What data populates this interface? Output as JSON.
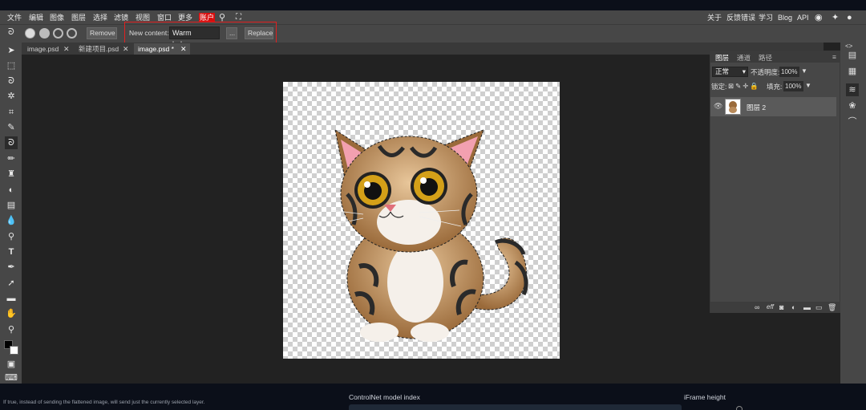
{
  "menu": {
    "items": [
      "文件",
      "编辑",
      "图像",
      "图层",
      "选择",
      "滤镜",
      "视图",
      "窗口",
      "更多",
      "账户"
    ],
    "right_links": [
      "关于",
      "反馈错误",
      "学习",
      "Blog",
      "API"
    ]
  },
  "options_bar": {
    "remove_label": "Remove",
    "new_content_label": "New content:",
    "new_content_value": "Warm balcony",
    "ellipsis_label": "...",
    "replace_label": "Replace"
  },
  "tabs": [
    {
      "label": "image.psd",
      "close": "✕"
    },
    {
      "label": "新建项目.psd",
      "close": "✕"
    },
    {
      "label": "image.psd *",
      "close": "✕"
    }
  ],
  "layers_panel": {
    "tabs": [
      "图层",
      "通道",
      "路径"
    ],
    "blend_mode": "正常",
    "opacity_label": "不透明度:",
    "opacity_value": "100%",
    "lock_label": "锁定:",
    "fill_label": "填充:",
    "fill_value": "100%",
    "layer_name": "图层 2",
    "bottom_eff": "eff"
  },
  "footer": {
    "hint": "If true, instead of sending the flattened image, will send just the currently selected layer.",
    "controlnet_label": "ControlNet model index",
    "iframe_label": "iFrame height"
  },
  "colors": {
    "accent_red": "#d90e0e",
    "highlight_red": "#e02020"
  }
}
